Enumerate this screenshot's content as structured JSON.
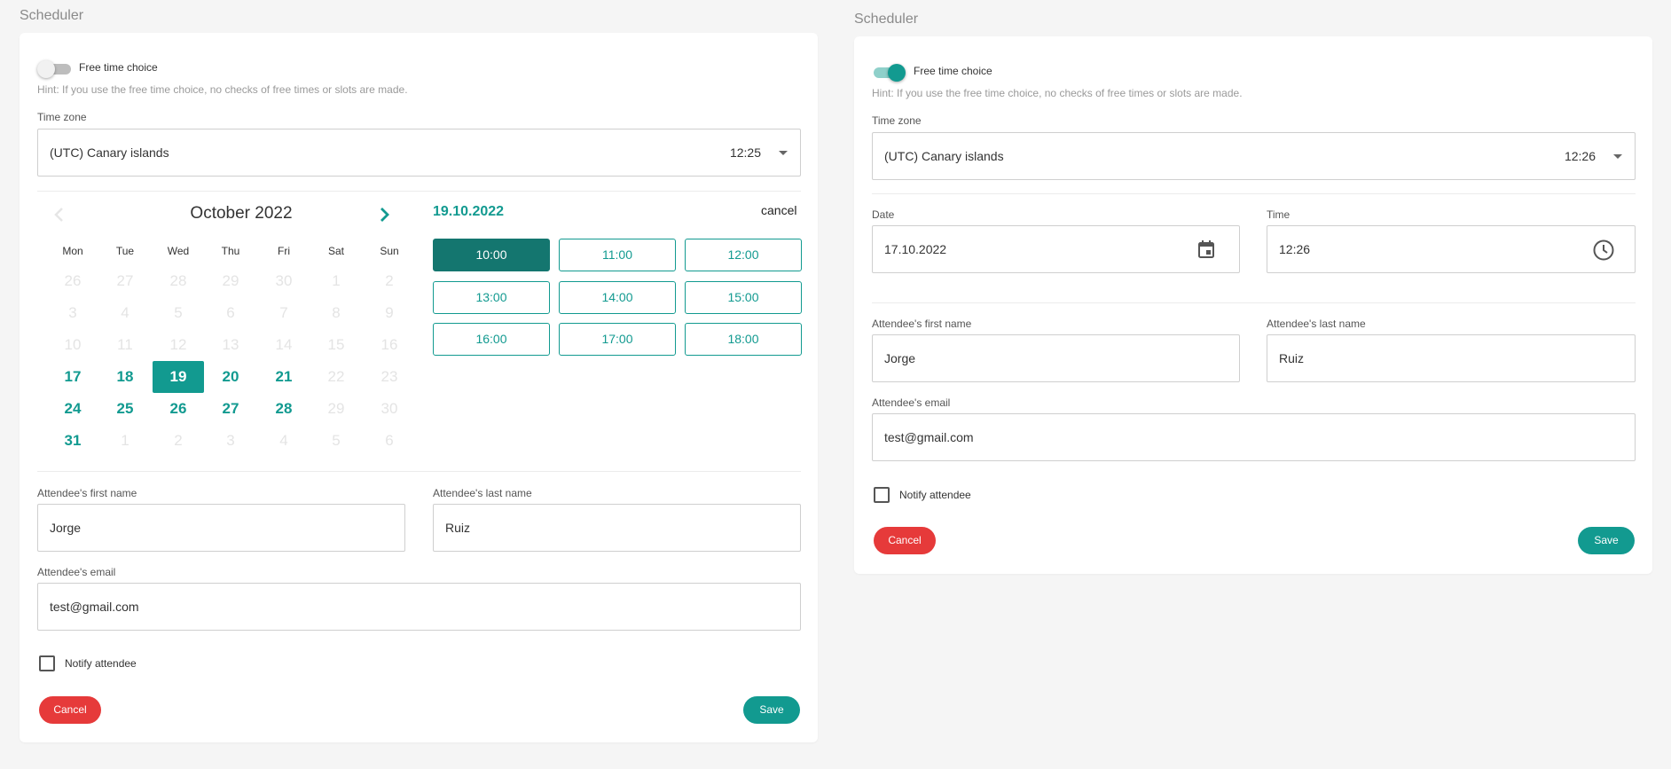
{
  "colors": {
    "accent": "#129a90",
    "accent_dark": "#14766f",
    "danger": "#e63a3a"
  },
  "left": {
    "title": "Scheduler",
    "free_time_label": "Free time choice",
    "free_time_on": false,
    "hint": "Hint: If you use the free time choice, no checks of free times or slots are made.",
    "timezone_label": "Time zone",
    "timezone_value": "(UTC) Canary islands",
    "timezone_time": "12:25",
    "calendar": {
      "month": "October 2022",
      "weekdays": [
        "Mon",
        "Tue",
        "Wed",
        "Thu",
        "Fri",
        "Sat",
        "Sun"
      ],
      "days": [
        [
          "26",
          "27",
          "28",
          "29",
          "30",
          "1",
          "2"
        ],
        [
          "3",
          "4",
          "5",
          "6",
          "7",
          "8",
          "9"
        ],
        [
          "10",
          "11",
          "12",
          "13",
          "14",
          "15",
          "16"
        ],
        [
          "17",
          "18",
          "19",
          "20",
          "21",
          "22",
          "23"
        ],
        [
          "24",
          "25",
          "26",
          "27",
          "28",
          "29",
          "30"
        ],
        [
          "31",
          "1",
          "2",
          "3",
          "4",
          "5",
          "6"
        ]
      ],
      "selected_date": "19.10.2022",
      "cancel_label": "cancel",
      "slots": [
        "10:00",
        "11:00",
        "12:00",
        "13:00",
        "14:00",
        "15:00",
        "16:00",
        "17:00",
        "18:00"
      ],
      "selected_slot": "10:00"
    },
    "first_name_label": "Attendee's first name",
    "first_name": "Jorge",
    "last_name_label": "Attendee's last name",
    "last_name": "Ruiz",
    "email_label": "Attendee's email",
    "email": "test@gmail.com",
    "notify_label": "Notify attendee",
    "cancel_button": "Cancel",
    "save_button": "Save"
  },
  "right": {
    "title": "Scheduler",
    "free_time_label": "Free time choice",
    "free_time_on": true,
    "hint": "Hint: If you use the free time choice, no checks of free times or slots are made.",
    "timezone_label": "Time zone",
    "timezone_value": "(UTC) Canary islands",
    "timezone_time": "12:26",
    "date_label": "Date",
    "date_value": "17.10.2022",
    "time_label": "Time",
    "time_value": "12:26",
    "first_name_label": "Attendee's first name",
    "first_name": "Jorge",
    "last_name_label": "Attendee's last name",
    "last_name": "Ruiz",
    "email_label": "Attendee's email",
    "email": "test@gmail.com",
    "notify_label": "Notify attendee",
    "cancel_button": "Cancel",
    "save_button": "Save"
  }
}
